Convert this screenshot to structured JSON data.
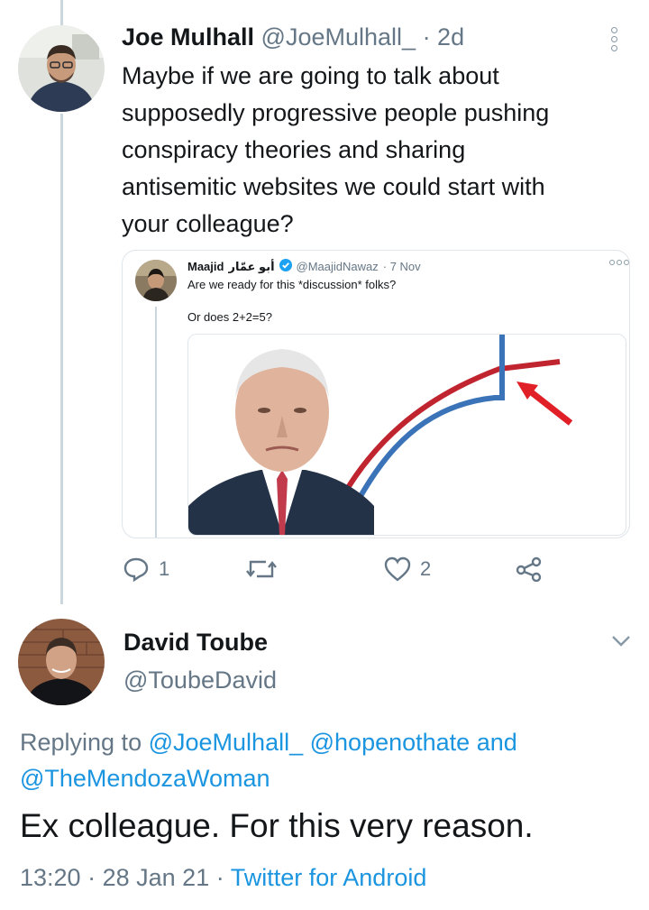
{
  "tweet1": {
    "display_name": "Joe Mulhall",
    "handle": "@JoeMulhall_",
    "time": "· 2d",
    "text_lines": [
      "Maybe if we are going to talk about",
      "supposedly progressive people pushing",
      "conspiracy theories and sharing",
      "antisemitic websites we could start with",
      "your colleague?"
    ],
    "actions": {
      "reply_count": "1",
      "retweet_count": "",
      "like_count": "2"
    }
  },
  "quoted": {
    "name": "Maajid",
    "name_arabic": "أبو عمّار",
    "handle": "@MaajidNawaz",
    "time": "· 7 Nov",
    "line1": "Are we ready for this *discussion* folks?",
    "line2": "Or does 2+2=5?",
    "chart_colors": {
      "red_line": "#c0242f",
      "blue_line": "#3b73b8",
      "arrow": "#e01f26"
    }
  },
  "tweet2": {
    "display_name": "David Toube",
    "handle": "@ToubeDavid",
    "replying_prefix": "Replying to",
    "replying_users": [
      "@JoeMulhall_",
      "@hopenothate",
      "and",
      "@TheMendozaWoman"
    ],
    "text": "Ex colleague. For this very reason.",
    "time": "13:20",
    "sep1": "·",
    "date": "28 Jan 21",
    "sep2": "·",
    "source": "Twitter for Android"
  },
  "icons": [
    "reply-icon",
    "retweet-icon",
    "like-icon",
    "share-icon",
    "more-icon",
    "chevron-down-icon",
    "verified-icon"
  ],
  "colors": {
    "link": "#1b95e0",
    "muted": "#657786",
    "text": "#14171a",
    "divider": "#ccd6dd"
  }
}
